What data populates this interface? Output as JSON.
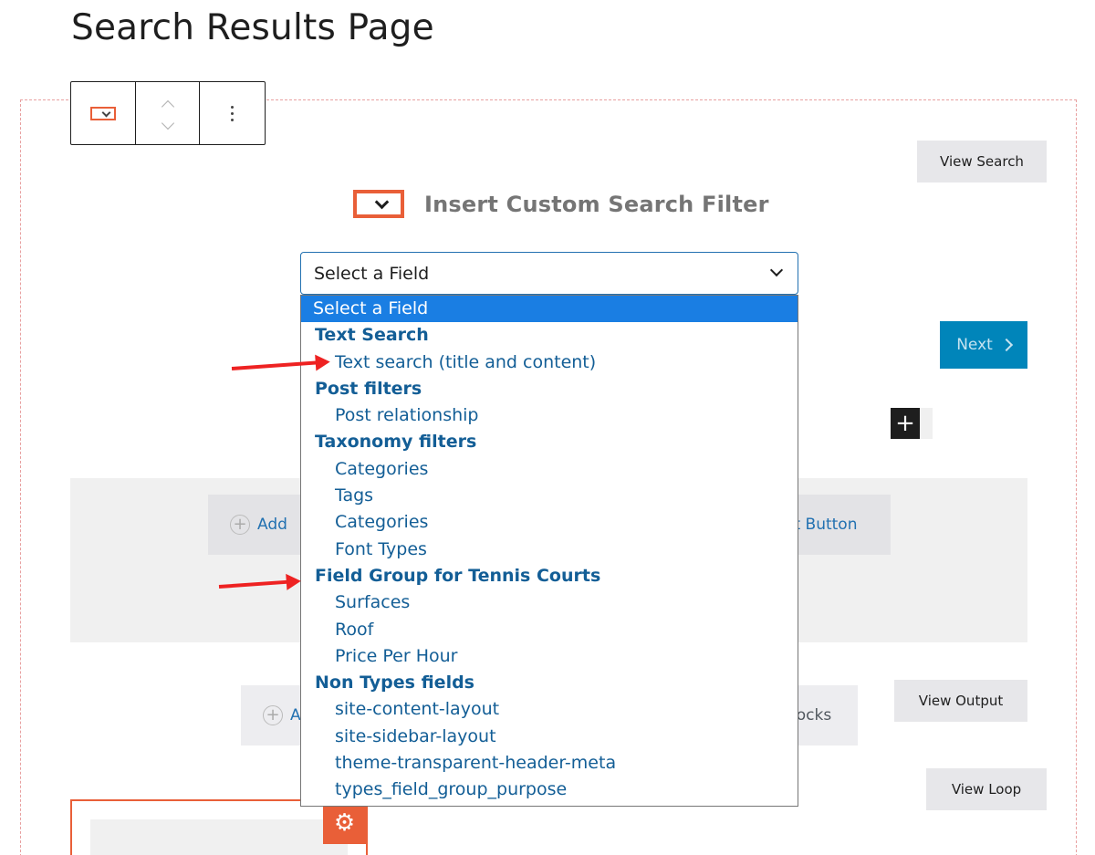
{
  "page": {
    "title": "Search Results Page"
  },
  "toolbar": {
    "block_icon": "custom-search-filter-icon",
    "mover_icons": [
      "chevron-up-icon",
      "chevron-down-icon"
    ],
    "options_icon": "more-vertical-icon"
  },
  "buttons": {
    "view_search": "View Search",
    "view_output": "View Output",
    "view_loop": "View Loop",
    "next": "Next",
    "add": "Add",
    "reset": "et Button",
    "add2": "A",
    "blocks": "locks"
  },
  "filter": {
    "title": "Insert Custom Search Filter"
  },
  "select": {
    "value": "Select a Field",
    "options": [
      {
        "type": "selected",
        "label": "Select a Field"
      },
      {
        "type": "group",
        "label": "Text Search"
      },
      {
        "type": "option",
        "label": "Text search (title and content)"
      },
      {
        "type": "group",
        "label": "Post filters"
      },
      {
        "type": "option",
        "label": "Post relationship"
      },
      {
        "type": "group",
        "label": "Taxonomy filters"
      },
      {
        "type": "option",
        "label": "Categories"
      },
      {
        "type": "option",
        "label": "Tags"
      },
      {
        "type": "option",
        "label": "Categories"
      },
      {
        "type": "option",
        "label": "Font Types"
      },
      {
        "type": "group",
        "label": "Field Group for Tennis Courts"
      },
      {
        "type": "option",
        "label": "Surfaces"
      },
      {
        "type": "option",
        "label": "Roof"
      },
      {
        "type": "option",
        "label": "Price Per Hour"
      },
      {
        "type": "group",
        "label": "Non Types fields"
      },
      {
        "type": "option",
        "label": "site-content-layout"
      },
      {
        "type": "option",
        "label": "site-sidebar-layout"
      },
      {
        "type": "option",
        "label": "theme-transparent-header-meta"
      },
      {
        "type": "option",
        "label": "types_field_group_purpose"
      }
    ]
  },
  "colors": {
    "accent": "#e95f38",
    "primary": "#0085ba",
    "link": "#135e96",
    "highlight": "#1a7ee3",
    "annotation": "#ee2222"
  }
}
